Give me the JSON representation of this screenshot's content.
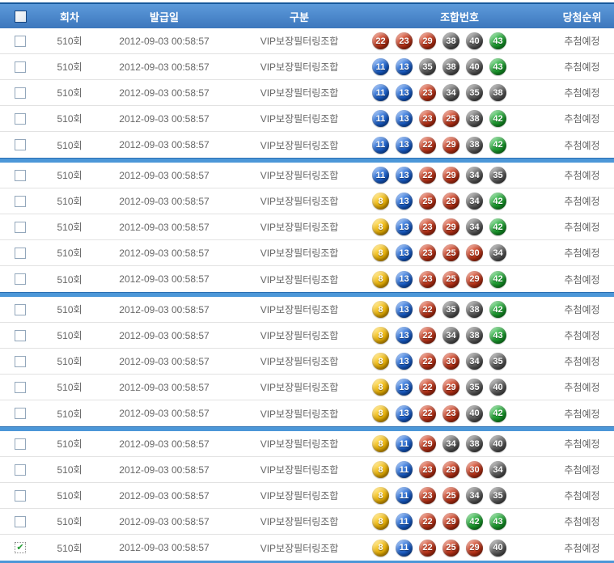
{
  "header": {
    "columns": [
      {
        "key": "round",
        "label": "회차"
      },
      {
        "key": "issued",
        "label": "발급일"
      },
      {
        "key": "category",
        "label": "구분"
      },
      {
        "key": "numbers",
        "label": "조합번호"
      },
      {
        "key": "rank",
        "label": "당첨순위"
      }
    ]
  },
  "group_size": 5,
  "ball_colors": {
    "range_1_10": "#e6ac00",
    "range_11_20": "#155bc9",
    "range_21_30": "#b92f14",
    "range_31_40": "#555555",
    "range_41_45": "#169a29"
  },
  "accent_colors": {
    "header_bar": "#3c77bd",
    "header_bar_top": "#17599c",
    "group_divider": "#4c97d8",
    "row_border": "#e2e2e2",
    "row_text": "#666666",
    "check_green": "#1f9a30"
  },
  "rows": [
    {
      "checked": false,
      "round": "510회",
      "issued": "2012-09-03 00:58:57",
      "category": "VIP보장필터링조합",
      "numbers": [
        22,
        23,
        29,
        38,
        40,
        43
      ],
      "status": "추첨예정"
    },
    {
      "checked": false,
      "round": "510회",
      "issued": "2012-09-03 00:58:57",
      "category": "VIP보장필터링조합",
      "numbers": [
        11,
        13,
        35,
        38,
        40,
        43
      ],
      "status": "추첨예정"
    },
    {
      "checked": false,
      "round": "510회",
      "issued": "2012-09-03 00:58:57",
      "category": "VIP보장필터링조합",
      "numbers": [
        11,
        13,
        23,
        34,
        35,
        38
      ],
      "status": "추첨예정"
    },
    {
      "checked": false,
      "round": "510회",
      "issued": "2012-09-03 00:58:57",
      "category": "VIP보장필터링조합",
      "numbers": [
        11,
        13,
        23,
        25,
        38,
        42
      ],
      "status": "추첨예정"
    },
    {
      "checked": false,
      "round": "510회",
      "issued": "2012-09-03 00:58:57",
      "category": "VIP보장필터링조합",
      "numbers": [
        11,
        13,
        22,
        29,
        38,
        42
      ],
      "status": "추첨예정"
    },
    {
      "checked": false,
      "round": "510회",
      "issued": "2012-09-03 00:58:57",
      "category": "VIP보장필터링조합",
      "numbers": [
        11,
        13,
        22,
        29,
        34,
        35
      ],
      "status": "추첨예정"
    },
    {
      "checked": false,
      "round": "510회",
      "issued": "2012-09-03 00:58:57",
      "category": "VIP보장필터링조합",
      "numbers": [
        8,
        13,
        25,
        29,
        34,
        42
      ],
      "status": "추첨예정"
    },
    {
      "checked": false,
      "round": "510회",
      "issued": "2012-09-03 00:58:57",
      "category": "VIP보장필터링조합",
      "numbers": [
        8,
        13,
        23,
        29,
        34,
        42
      ],
      "status": "추첨예정"
    },
    {
      "checked": false,
      "round": "510회",
      "issued": "2012-09-03 00:58:57",
      "category": "VIP보장필터링조합",
      "numbers": [
        8,
        13,
        23,
        25,
        30,
        34
      ],
      "status": "추첨예정"
    },
    {
      "checked": false,
      "round": "510회",
      "issued": "2012-09-03 00:58:57",
      "category": "VIP보장필터링조합",
      "numbers": [
        8,
        13,
        23,
        25,
        29,
        42
      ],
      "status": "추첨예정"
    },
    {
      "checked": false,
      "round": "510회",
      "issued": "2012-09-03 00:58:57",
      "category": "VIP보장필터링조합",
      "numbers": [
        8,
        13,
        22,
        35,
        38,
        42
      ],
      "status": "추첨예정"
    },
    {
      "checked": false,
      "round": "510회",
      "issued": "2012-09-03 00:58:57",
      "category": "VIP보장필터링조합",
      "numbers": [
        8,
        13,
        22,
        34,
        38,
        43
      ],
      "status": "추첨예정"
    },
    {
      "checked": false,
      "round": "510회",
      "issued": "2012-09-03 00:58:57",
      "category": "VIP보장필터링조합",
      "numbers": [
        8,
        13,
        22,
        30,
        34,
        35
      ],
      "status": "추첨예정"
    },
    {
      "checked": false,
      "round": "510회",
      "issued": "2012-09-03 00:58:57",
      "category": "VIP보장필터링조합",
      "numbers": [
        8,
        13,
        22,
        29,
        35,
        40
      ],
      "status": "추첨예정"
    },
    {
      "checked": false,
      "round": "510회",
      "issued": "2012-09-03 00:58:57",
      "category": "VIP보장필터링조합",
      "numbers": [
        8,
        13,
        22,
        23,
        40,
        42
      ],
      "status": "추첨예정"
    },
    {
      "checked": false,
      "round": "510회",
      "issued": "2012-09-03 00:58:57",
      "category": "VIP보장필터링조합",
      "numbers": [
        8,
        11,
        29,
        34,
        38,
        40
      ],
      "status": "추첨예정"
    },
    {
      "checked": false,
      "round": "510회",
      "issued": "2012-09-03 00:58:57",
      "category": "VIP보장필터링조합",
      "numbers": [
        8,
        11,
        23,
        29,
        30,
        34
      ],
      "status": "추첨예정"
    },
    {
      "checked": false,
      "round": "510회",
      "issued": "2012-09-03 00:58:57",
      "category": "VIP보장필터링조합",
      "numbers": [
        8,
        11,
        23,
        25,
        34,
        35
      ],
      "status": "추첨예정"
    },
    {
      "checked": false,
      "round": "510회",
      "issued": "2012-09-03 00:58:57",
      "category": "VIP보장필터링조합",
      "numbers": [
        8,
        11,
        22,
        29,
        42,
        43
      ],
      "status": "추첨예정"
    },
    {
      "checked": true,
      "round": "510회",
      "issued": "2012-09-03 00:58:57",
      "category": "VIP보장필터링조합",
      "numbers": [
        8,
        11,
        22,
        25,
        29,
        40
      ],
      "status": "추첨예정"
    }
  ],
  "checkmark_glyph": "✔"
}
